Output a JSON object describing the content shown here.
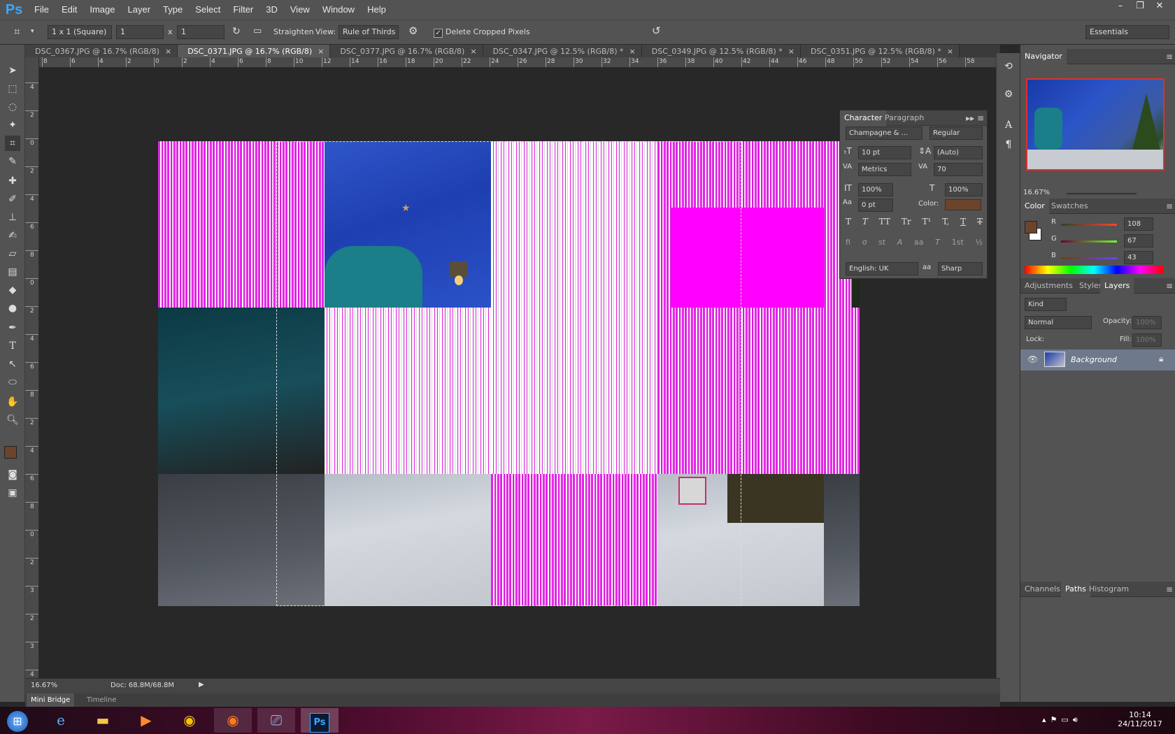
{
  "app": {
    "logo": "Ps"
  },
  "menubar": {
    "items": [
      "File",
      "Edit",
      "Image",
      "Layer",
      "Type",
      "Select",
      "Filter",
      "3D",
      "View",
      "Window",
      "Help"
    ]
  },
  "window": {
    "minimize": "–",
    "restore": "❐",
    "close": "✕"
  },
  "options": {
    "ratio": "1 x 1 (Square)",
    "width": "1",
    "times": "x",
    "height": "1",
    "straighten_label": "Straighten",
    "view_label": "View:",
    "view_value": "Rule of Thirds",
    "delete_cropped": "Delete Cropped Pixels",
    "workspace": "Essentials"
  },
  "tabs": [
    {
      "label": "DSC_0367.JPG @ 16.7% (RGB/8)"
    },
    {
      "label": "DSC_0371.JPG @ 16.7% (RGB/8)"
    },
    {
      "label": "DSC_0377.JPG @ 16.7% (RGB/8)"
    },
    {
      "label": "DSC_0347.JPG @ 12.5% (RGB/8) *"
    },
    {
      "label": "DSC_0349.JPG @ 12.5% (RGB/8) *"
    },
    {
      "label": "DSC_0351.JPG @ 12.5% (RGB/8) *"
    }
  ],
  "ruler_h": [
    "8",
    "6",
    "4",
    "2",
    "0",
    "2",
    "4",
    "6",
    "8",
    "10",
    "12",
    "14",
    "16",
    "18",
    "20",
    "22",
    "24",
    "26",
    "28",
    "30",
    "32",
    "34",
    "36",
    "38",
    "40",
    "42",
    "44",
    "46",
    "48",
    "50",
    "52",
    "54",
    "56",
    "58"
  ],
  "ruler_v": [
    "4",
    "2",
    "0",
    "2",
    "4",
    "6",
    "8",
    "0",
    "2",
    "4",
    "6",
    "8",
    "2",
    "4",
    "6",
    "8",
    "0",
    "2",
    "3",
    "2",
    "3",
    "4"
  ],
  "tools": [
    "move-icon",
    "marquee-icon",
    "lasso-icon",
    "magic-wand-icon",
    "crop-icon",
    "eyedropper-icon",
    "healing-icon",
    "brush-icon",
    "stamp-icon",
    "history-brush-icon",
    "eraser-icon",
    "gradient-icon",
    "blur-icon",
    "dodge-icon",
    "pen-icon",
    "type-icon",
    "path-select-icon",
    "shape-icon",
    "hand-icon",
    "zoom-icon"
  ],
  "colors": {
    "foreground": "#6c432b",
    "background": "#ffffff"
  },
  "navigator": {
    "title": "Navigator",
    "zoom": "16.67%"
  },
  "character": {
    "tab1": "Character",
    "tab2": "Paragraph",
    "font": "Champagne & ...",
    "style": "Regular",
    "size": "10 pt",
    "leading": "(Auto)",
    "kerning": "Metrics",
    "tracking": "70",
    "vscale": "100%",
    "hscale": "100%",
    "baseline": "0 pt",
    "color_label": "Color:",
    "language": "English: UK",
    "aa_label": "aa",
    "aa": "Sharp",
    "styles": [
      "T",
      "T",
      "TT",
      "Tr",
      "T¹",
      "T,",
      "T",
      "T"
    ],
    "opentype": [
      "fi",
      "ơ",
      "st",
      "A",
      "aa",
      "T",
      "1st",
      "½"
    ]
  },
  "colorpanel": {
    "tab1": "Color",
    "tab2": "Swatches",
    "r_label": "R",
    "g_label": "G",
    "b_label": "B",
    "r": "108",
    "g": "67",
    "b": "43",
    "swatch": "#6c432b"
  },
  "layerspanel": {
    "tab1": "Adjustments",
    "tab2": "Styles",
    "tab3": "Layers",
    "kind": "Kind",
    "blend": "Normal",
    "opacity_label": "Opacity:",
    "opacity": "100%",
    "lock_label": "Lock:",
    "fill_label": "Fill:",
    "fill": "100%",
    "layer_name": "Background"
  },
  "bottompanels": {
    "tab1": "Channels",
    "tab2": "Paths",
    "tab3": "Histogram"
  },
  "status": {
    "zoom": "16.67%",
    "doc": "Doc: 68.8M/68.8M"
  },
  "bottomtabs": {
    "tab1": "Mini Bridge",
    "tab2": "Timeline"
  },
  "taskbar": {
    "time": "10:14",
    "date": "24/11/2017"
  }
}
